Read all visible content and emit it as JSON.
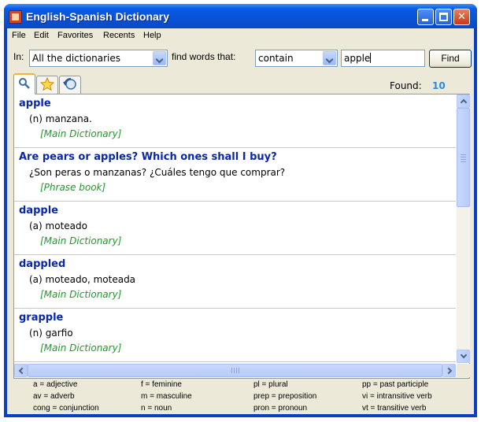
{
  "window": {
    "title": "English-Spanish Dictionary"
  },
  "menu": [
    "File",
    "Edit",
    "Favorites",
    "Recents",
    "Help"
  ],
  "search": {
    "in_label": "In:",
    "scope_value": "All the dictionaries",
    "find_label": "find words that:",
    "mode_value": "contain",
    "query_value": "apple",
    "find_button": "Find"
  },
  "tabs": [
    {
      "icon": "search-icon"
    },
    {
      "icon": "star-icon"
    },
    {
      "icon": "history-icon"
    }
  ],
  "found": {
    "label": "Found:",
    "count": "10"
  },
  "results": [
    {
      "headword": "apple",
      "definition": "(n) manzana.",
      "source": "[Main Dictionary]"
    },
    {
      "headword": "Are pears or apples? Which ones shall I buy?",
      "definition": "¿Son peras o manzanas? ¿Cuáles tengo que comprar?",
      "source": "[Phrase book]"
    },
    {
      "headword": "dapple",
      "definition": "(a) moteado",
      "source": "[Main Dictionary]"
    },
    {
      "headword": "dappled",
      "definition": "(a) moteado, moteada",
      "source": "[Main Dictionary]"
    },
    {
      "headword": "grapple",
      "definition": "(n) garfio",
      "source": "[Main Dictionary]"
    }
  ],
  "legend": [
    [
      "a = adjective",
      "av = adverb",
      "cong = conjunction"
    ],
    [
      "f = feminine",
      "m = masculine",
      "n = noun"
    ],
    [
      "pl = plural",
      "prep = preposition",
      "pron = pronoun"
    ],
    [
      "pp = past participle",
      "vi = intransitive verb",
      "vt = transitive verb"
    ]
  ],
  "colors": {
    "headword": "#0a27a8",
    "source": "#1f9a2c",
    "found_count": "#2c8bd8",
    "titlebar": "#0a5ae3"
  }
}
